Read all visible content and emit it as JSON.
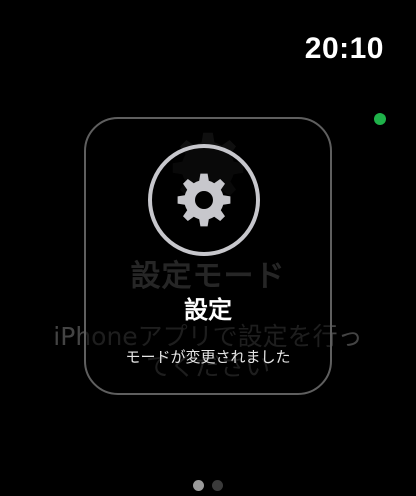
{
  "status": {
    "time": "20:10",
    "indicator_color": "#1fb24a"
  },
  "background": {
    "icon": "gear-icon",
    "title": "設定モード",
    "description_line1": "iPhoneアプリで設定を行っ",
    "description_line2": "てください"
  },
  "hud": {
    "icon": "gear-icon",
    "title": "設定",
    "message": "モードが変更されました"
  },
  "pager": {
    "count": 2,
    "active_index": 0
  }
}
